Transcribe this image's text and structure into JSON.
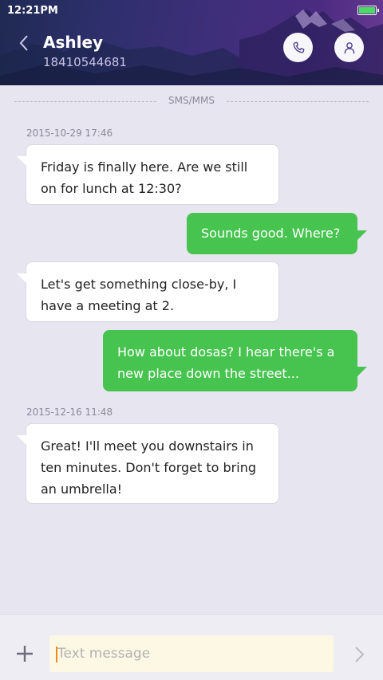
{
  "status_bar": {
    "time": "12:21PM",
    "battery_color": "#4cd964"
  },
  "header": {
    "contact_name": "Ashley",
    "contact_number": "18410544681",
    "back_icon": "chevron-left-icon",
    "call_icon": "phone-icon",
    "contact_icon": "person-icon"
  },
  "thread": {
    "divider_label": "SMS/MMS",
    "timestamps": [
      "2015-10-29 17:46",
      "2015-12-16 11:48"
    ],
    "messages": [
      {
        "direction": "incoming",
        "text": "Friday is finally here. Are we still on for lunch at 12:30?"
      },
      {
        "direction": "outgoing",
        "text": "Sounds good. Where?"
      },
      {
        "direction": "incoming",
        "text": "Let's get something close-by, I have a meeting at 2."
      },
      {
        "direction": "outgoing",
        "text": "How about dosas? I hear there's a new place down the street..."
      },
      {
        "direction": "incoming",
        "text": "Great! I'll meet you downstairs in ten minutes. Don't forget to bring an umbrella!"
      }
    ]
  },
  "composer": {
    "placeholder": "Text message",
    "value": "",
    "add_icon": "plus-icon",
    "send_icon": "chevron-right-icon"
  },
  "colors": {
    "outgoing_bubble": "#47c450",
    "incoming_bubble": "#ffffff",
    "background": "#e7e6f0",
    "header_accent": "#4a2b80",
    "composer_field": "#fdf8e4"
  }
}
